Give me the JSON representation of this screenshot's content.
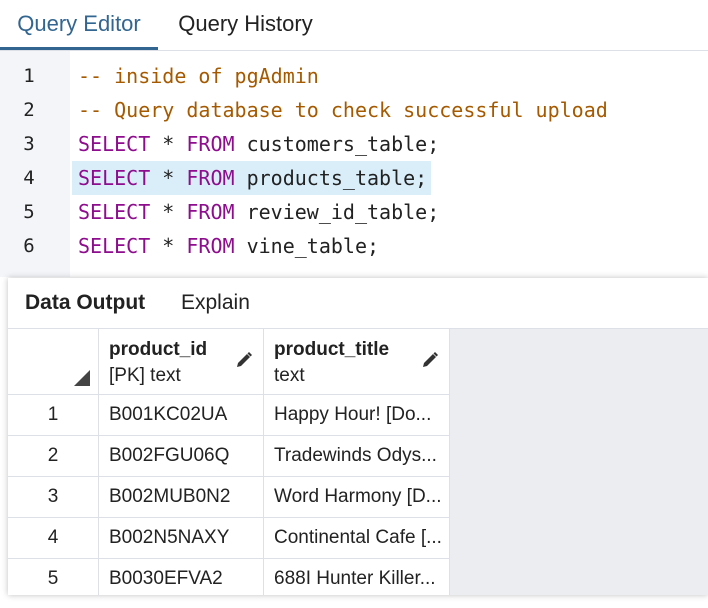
{
  "top_tabs": [
    {
      "label": "Query Editor",
      "active": true
    },
    {
      "label": "Query History",
      "active": false
    }
  ],
  "editor": {
    "lines": [
      {
        "n": "1",
        "parts": [
          {
            "t": "-- inside of pgAdmin",
            "c": "comment"
          }
        ]
      },
      {
        "n": "2",
        "parts": [
          {
            "t": "-- Query database to check successful upload",
            "c": "comment"
          }
        ]
      },
      {
        "n": "3",
        "parts": [
          {
            "t": "SELECT",
            "c": "kw"
          },
          {
            "t": " * ",
            "c": "op"
          },
          {
            "t": "FROM",
            "c": "kw"
          },
          {
            "t": " customers_table;",
            "c": "op"
          }
        ]
      },
      {
        "n": "4",
        "highlight": true,
        "parts": [
          {
            "t": "SELECT",
            "c": "kw"
          },
          {
            "t": " * ",
            "c": "op"
          },
          {
            "t": "FROM",
            "c": "kw"
          },
          {
            "t": " products_table;",
            "c": "op"
          }
        ]
      },
      {
        "n": "5",
        "parts": [
          {
            "t": "SELECT",
            "c": "kw"
          },
          {
            "t": " * ",
            "c": "op"
          },
          {
            "t": "FROM",
            "c": "kw"
          },
          {
            "t": " review_id_table;",
            "c": "op"
          }
        ]
      },
      {
        "n": "6",
        "parts": [
          {
            "t": "SELECT",
            "c": "kw"
          },
          {
            "t": " * ",
            "c": "op"
          },
          {
            "t": "FROM",
            "c": "kw"
          },
          {
            "t": " vine_table;",
            "c": "op"
          }
        ]
      }
    ]
  },
  "output": {
    "tabs": [
      {
        "label": "Data Output",
        "active": true
      },
      {
        "label": "Explain",
        "active": false
      }
    ],
    "columns": [
      {
        "name": "product_id",
        "type": "[PK] text"
      },
      {
        "name": "product_title",
        "type": "text"
      }
    ],
    "rows": [
      {
        "n": "1",
        "product_id": "B001KC02UA",
        "product_title": "Happy Hour! [Do..."
      },
      {
        "n": "2",
        "product_id": "B002FGU06Q",
        "product_title": "Tradewinds Odys..."
      },
      {
        "n": "3",
        "product_id": "B002MUB0N2",
        "product_title": "Word Harmony [D..."
      },
      {
        "n": "4",
        "product_id": "B002N5NAXY",
        "product_title": "Continental Cafe [..."
      },
      {
        "n": "5",
        "product_id": "B0030EFVA2",
        "product_title": "688I Hunter Killer..."
      }
    ]
  }
}
